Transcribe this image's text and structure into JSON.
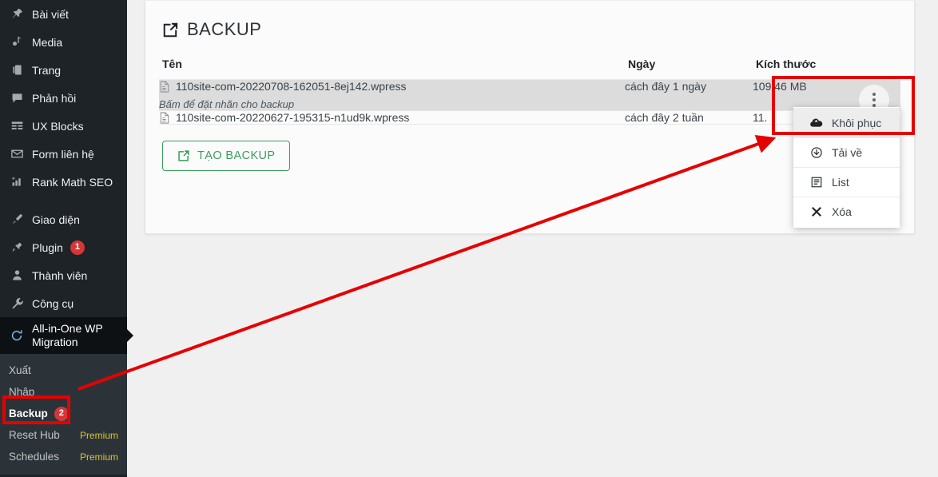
{
  "sidebar": {
    "items": [
      {
        "label": "Bài viết",
        "icon": "pin-icon",
        "badge": null
      },
      {
        "label": "Media",
        "icon": "media-icon",
        "badge": null
      },
      {
        "label": "Trang",
        "icon": "pages-icon",
        "badge": null
      },
      {
        "label": "Phản hồi",
        "icon": "comment-icon",
        "badge": null
      },
      {
        "label": "UX Blocks",
        "icon": "blocks-icon",
        "badge": null
      },
      {
        "label": "Form liên hệ",
        "icon": "envelope-icon",
        "badge": null
      },
      {
        "label": "Rank Math SEO",
        "icon": "seo-chart-icon",
        "badge": null
      },
      {
        "label": "Giao diện",
        "icon": "brush-icon",
        "badge": null
      },
      {
        "label": "Plugin",
        "icon": "plug-icon",
        "badge": "1"
      },
      {
        "label": "Thành viên",
        "icon": "user-icon",
        "badge": null
      },
      {
        "label": "Công cụ",
        "icon": "wrench-icon",
        "badge": null
      },
      {
        "label": "All-in-One WP Migration",
        "icon": "migration-icon",
        "badge": null
      }
    ],
    "submenu": [
      {
        "label": "Xuất",
        "badge": null,
        "tag": null
      },
      {
        "label": "Nhập",
        "badge": null,
        "tag": null
      },
      {
        "label": "Backup",
        "badge": "2",
        "tag": null
      },
      {
        "label": "Reset Hub",
        "badge": null,
        "tag": "Premium"
      },
      {
        "label": "Schedules",
        "badge": null,
        "tag": "Premium"
      }
    ]
  },
  "panel": {
    "title": "BACKUP",
    "title_icon": "export-icon",
    "table": {
      "headers": {
        "name": "Tên",
        "date": "Ngày",
        "size": "Kích thước"
      },
      "rows": [
        {
          "name": "110site-com-20220708-162051-8ej142.wpress",
          "note": "Bấm để đặt nhãn cho backup",
          "date": "cách đây 1 ngày",
          "size": "109,46 MB"
        },
        {
          "name": "110site-com-20220627-195315-n1ud9k.wpress",
          "note": "",
          "date": "cách đây 2 tuần",
          "size": "11."
        }
      ]
    },
    "create_button": {
      "label": "TẠO BACKUP",
      "icon": "export-icon"
    }
  },
  "action_menu": {
    "items": [
      {
        "label": "Khôi phục",
        "icon": "cloud-restore-icon"
      },
      {
        "label": "Tải về",
        "icon": "download-icon"
      },
      {
        "label": "List",
        "icon": "list-icon"
      },
      {
        "label": "Xóa",
        "icon": "close-x-icon"
      }
    ]
  },
  "colors": {
    "sidebar_bg": "#1d2327",
    "submenu_bg": "#2c3338",
    "accent_green": "#3a9d5d",
    "badge_red": "#d63638",
    "premium_yellow": "#d8c52e",
    "annotation_red": "#e60000",
    "row_highlight": "#dcdcdc"
  }
}
